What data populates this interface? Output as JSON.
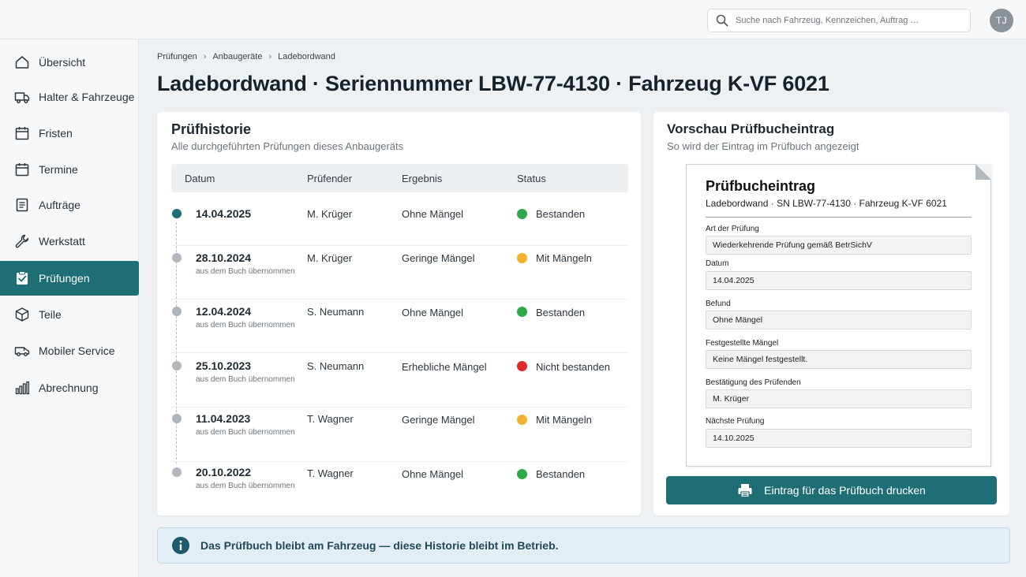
{
  "topbar": {
    "search_placeholder": "Suche nach Fahrzeug, Kennzeichen, Auftrag …",
    "avatar_initials": "TJ"
  },
  "sidebar": {
    "items": [
      {
        "label": "Übersicht",
        "icon": "home-icon"
      },
      {
        "label": "Halter & Fahrzeuge",
        "icon": "truck-icon"
      },
      {
        "label": "Fristen",
        "icon": "calendar-icon"
      },
      {
        "label": "Termine",
        "icon": "calendar-icon"
      },
      {
        "label": "Aufträge",
        "icon": "document-icon"
      },
      {
        "label": "Werkstatt",
        "icon": "wrench-icon"
      },
      {
        "label": "Prüfungen",
        "icon": "clipboard-check-icon",
        "active": true
      },
      {
        "label": "Teile",
        "icon": "box-icon"
      },
      {
        "label": "Mobiler Service",
        "icon": "van-icon"
      },
      {
        "label": "Abrechnung",
        "icon": "bar-chart-icon"
      }
    ],
    "active_color": "#1e6e76"
  },
  "breadcrumb": [
    "Prüfungen",
    "Anbaugeräte",
    "Ladebordwand"
  ],
  "page_title": "Ladebordwand · Seriennummer LBW-77-4130 · Fahrzeug K-VF 6021",
  "history": {
    "title": "Prüfhistorie",
    "subtitle": "Alle durchgeführten Prüfungen dieses Anbaugeräts",
    "columns": [
      "Datum",
      "Prüfender",
      "Ergebnis",
      "Status"
    ],
    "rows": [
      {
        "date": "14.04.2025",
        "note": "",
        "inspector": "M. Krüger",
        "result": "Ohne Mängel",
        "status": "Bestanden",
        "status_color": "#2eaa4a",
        "current": true
      },
      {
        "date": "28.10.2024",
        "note": "aus dem Buch übernommen",
        "inspector": "M. Krüger",
        "result": "Geringe Mängel",
        "status": "Mit Mängeln",
        "status_color": "#f2b230"
      },
      {
        "date": "12.04.2024",
        "note": "aus dem Buch übernommen",
        "inspector": "S. Neumann",
        "result": "Ohne Mängel",
        "status": "Bestanden",
        "status_color": "#2eaa4a"
      },
      {
        "date": "25.10.2023",
        "note": "aus dem Buch übernommen",
        "inspector": "S. Neumann",
        "result": "Erhebliche Mängel",
        "status": "Nicht bestanden",
        "status_color": "#e2272b"
      },
      {
        "date": "11.04.2023",
        "note": "aus dem Buch übernommen",
        "inspector": "T. Wagner",
        "result": "Geringe Mängel",
        "status": "Mit Mängeln",
        "status_color": "#f2b230"
      },
      {
        "date": "20.10.2022",
        "note": "aus dem Buch übernommen",
        "inspector": "T. Wagner",
        "result": "Ohne Mängel",
        "status": "Bestanden",
        "status_color": "#2eaa4a"
      }
    ]
  },
  "preview": {
    "title": "Vorschau Prüfbucheintrag",
    "subtitle": "So wird der Eintrag im Prüfbuch angezeigt",
    "doc_title": "Prüfbucheintrag",
    "doc_meta": "Ladebordwand  ·  SN LBW-77-4130  ·  Fahrzeug K-VF 6021",
    "fields": [
      {
        "label": "Art der Prüfung",
        "value": "Wiederkehrende Prüfung gemäß BetrSichV"
      },
      {
        "label": "Datum",
        "value": "14.04.2025"
      },
      {
        "label": "Befund",
        "value": "Ohne Mängel"
      },
      {
        "label": "Festgestellte Mängel",
        "value": "Keine Mängel festgestellt."
      },
      {
        "label": "Bestätigung des Prüfenden",
        "value": "M. Krüger"
      },
      {
        "label": "Nächste Prüfung",
        "value": "14.10.2025"
      }
    ],
    "print_button": "Eintrag für das Prüfbuch drucken"
  },
  "info_banner": "Das Prüfbuch bleibt am Fahrzeug — diese Historie bleibt im Betrieb."
}
